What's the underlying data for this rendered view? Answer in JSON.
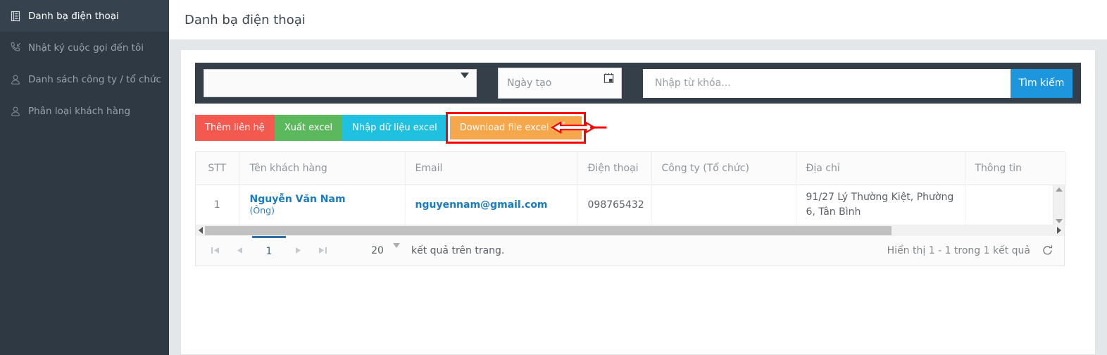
{
  "sidebar": {
    "items": [
      {
        "label": "Danh bạ điện thoại",
        "icon": "address-book-icon",
        "active": true
      },
      {
        "label": "Nhật ký cuộc gọi đến tôi",
        "icon": "incoming-call-icon",
        "active": false
      },
      {
        "label": "Danh sách công ty / tổ chức",
        "icon": "user-icon",
        "active": false
      },
      {
        "label": "Phân loại khách hàng",
        "icon": "user-icon",
        "active": false
      }
    ],
    "bg_color": "#2f3943",
    "active_bg_color": "#36424e"
  },
  "header": {
    "title": "Danh bạ điện thoại"
  },
  "filter": {
    "select_value": "",
    "date_placeholder": "Ngày tạo",
    "date_value": "",
    "keyword_placeholder": "Nhập từ khóa...",
    "keyword_value": "",
    "search_label": "Tìm kiếm",
    "search_color": "#1d96de",
    "bar_bg": "#353f4a"
  },
  "actions": {
    "buttons": [
      {
        "label": "Thêm liên hệ",
        "color": "#f4594f"
      },
      {
        "label": "Xuất excel",
        "color": "#5cb85c"
      },
      {
        "label": "Nhập dữ liệu excel",
        "color": "#1fc0e0"
      },
      {
        "label": "Download file excel mẫu",
        "color": "#f7a74b"
      }
    ],
    "highlight_color": "#ff0000",
    "annotation": "arrow-pointing-left-at-download-button"
  },
  "table": {
    "columns": [
      "STT",
      "Tên khách hàng",
      "Email",
      "Điện thoại",
      "Công ty (Tổ chức)",
      "Địa chỉ",
      "Thông tin"
    ],
    "rows": [
      {
        "stt": "1",
        "name": "Nguyễn Văn Nam",
        "title": "(Ông)",
        "email": "nguyennam@gmail.com",
        "phone": "098765432",
        "company": "",
        "address": "91/27 Lý Thường Kiệt, Phường 6, Tân Bình",
        "info": ""
      }
    ]
  },
  "pager": {
    "first_icon": "first-page-icon",
    "prev_icon": "prev-page-icon",
    "current_page": "1",
    "next_icon": "next-page-icon",
    "last_icon": "last-page-icon",
    "page_size": "20",
    "page_size_label": "kết quả trên trang.",
    "result_info": "Hiển thị 1 - 1 trong 1 kết quả",
    "refresh_icon": "refresh-icon"
  }
}
